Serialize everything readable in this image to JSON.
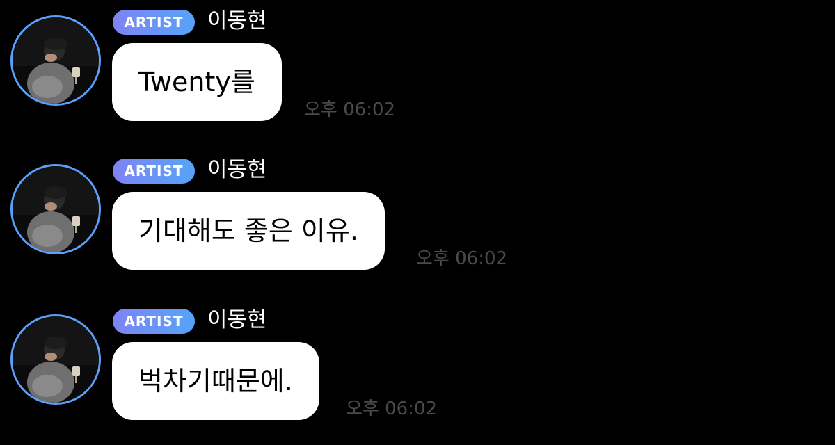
{
  "messages": [
    {
      "badge": "ARTIST",
      "name": "이동현",
      "text": "Twenty를",
      "time": "오후 06:02",
      "avatar_icon": "artist-avatar-photo"
    },
    {
      "badge": "ARTIST",
      "name": "이동현",
      "text": "기대해도 좋은 이유.",
      "time": "오후 06:02",
      "avatar_icon": "artist-avatar-photo"
    },
    {
      "badge": "ARTIST",
      "name": "이동현",
      "text": "벅차기때문에.",
      "time": "오후 06:02",
      "avatar_icon": "artist-avatar-photo"
    }
  ],
  "colors": {
    "background": "#000000",
    "bubble": "#ffffff",
    "badge_gradient_start": "#7f83f5",
    "badge_gradient_end": "#55a4f8",
    "avatar_ring": "#5aa0ff",
    "timestamp": "#4a4a4a"
  }
}
